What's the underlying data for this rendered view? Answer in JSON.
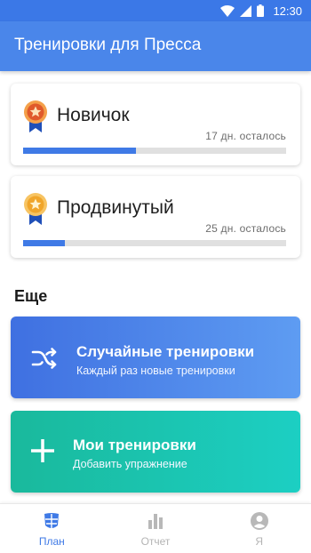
{
  "status_bar": {
    "time": "12:30",
    "icons": [
      "wifi-icon",
      "signal-icon",
      "battery-icon"
    ]
  },
  "app_bar": {
    "title": "Тренировки для Пресса"
  },
  "levels": [
    {
      "name": "Новичок",
      "days_left": "17 дн. осталось",
      "progress": 0.43,
      "medal_color": "#e8742a",
      "medal_icon": "medal-icon"
    },
    {
      "name": "Продвинутый",
      "days_left": "25 дн. осталось",
      "progress": 0.16,
      "medal_color": "#f2b233",
      "medal_icon": "medal-icon"
    }
  ],
  "more_section": {
    "title": "Еще"
  },
  "random_card": {
    "title": "Случайные тренировки",
    "subtitle": "Каждый раз новые тренировки",
    "icon": "shuffle-icon"
  },
  "mine_card": {
    "title": "Мои тренировки",
    "subtitle": "Добавить упражнение",
    "icon": "plus-icon"
  },
  "bottom_nav": {
    "items": [
      {
        "label": "План",
        "icon": "plan-icon",
        "active": true
      },
      {
        "label": "Отчет",
        "icon": "bar-chart-icon",
        "active": false
      },
      {
        "label": "Я",
        "icon": "profile-icon",
        "active": false
      }
    ]
  },
  "colors": {
    "primary": "#4a86ea",
    "status_bar": "#3b78e7",
    "progress": "#3f7ae6",
    "teal": "#1cc4b0"
  }
}
